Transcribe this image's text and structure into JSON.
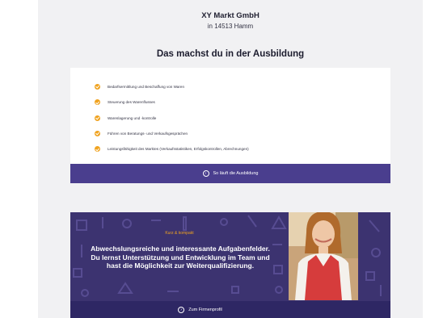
{
  "header": {
    "company": "XY Markt GmbH",
    "location": "in 14513 Hamm"
  },
  "training": {
    "title": "Das machst du in der Ausbildung",
    "tasks": [
      "Bedarfsermittlung und Beschaffung von Waren",
      "Steuerung des Warenflusses",
      "Warenlagerung und -kontrolle",
      "Führen von Beratungs- und Verkaufsgesprächen",
      "Leistungsfähigkeit des Marktes (Verkaufsstatistiken, Erfolgskontrollen, Abrechnungen)"
    ],
    "cta_label": "So läuft die Ausbildung"
  },
  "promo": {
    "kicker": "Kurz & kompakt",
    "headline": "Abwechslungsreiche und interessante Aufgabenfelder. Du lernst Unterstützung und Entwicklung im Team und hast die Möglichkeit zur Weiterqualifizierung.",
    "cta_label": "Zum Firmenprofil"
  },
  "colors": {
    "accent": "#f0a320",
    "brand_purple": "#4a3e8e",
    "promo_bg": "#3c3370"
  },
  "icons": {
    "task_bullet": "check-circle-icon",
    "cta": "circle-arrow-icon"
  }
}
